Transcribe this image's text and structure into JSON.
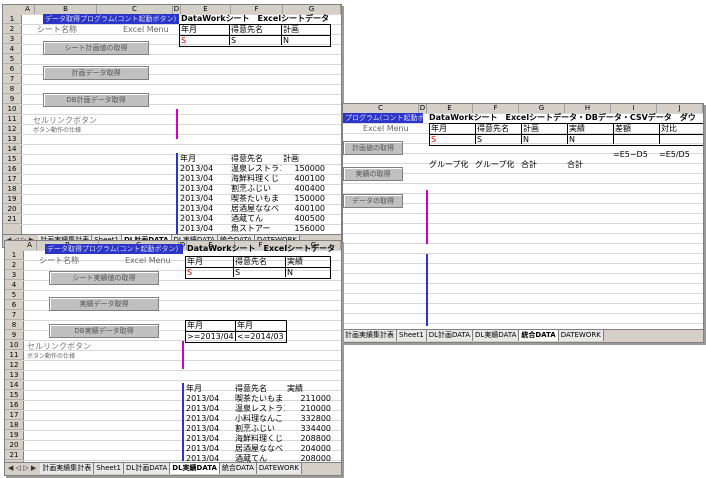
{
  "left_top": {
    "columns": [
      "A",
      "B",
      "C",
      "D",
      "E",
      "F",
      "G"
    ],
    "row_numbers": [
      "1",
      "2",
      "3",
      "4",
      "5",
      "6",
      "7",
      "8",
      "9",
      "10",
      "11",
      "12",
      "13",
      "14",
      "15",
      "16",
      "17",
      "18",
      "19",
      "20",
      "21"
    ],
    "bluebar_text": "データ取得プログラム(コント起動ボタン)",
    "header_strip": "DataWorkシート　Excelシートデータ",
    "menu_label_left": "シート名称",
    "menu_label_right": "Excel Menu",
    "buttons": [
      "シート計画値の取得",
      "計画データ取得",
      "DB計画データ取得"
    ],
    "cell_link_title": "セルリンクボタン",
    "cell_link_sub": "ボタン動作の仕様",
    "top_box": {
      "headers": [
        "年月",
        "得意先名",
        "計画"
      ],
      "values": [
        "S",
        "S",
        "N"
      ]
    },
    "table_headers": [
      "年月",
      "得意先名",
      "計画"
    ],
    "rows": [
      [
        "2013/04",
        "温泉レストラン",
        "150000"
      ],
      [
        "2013/04",
        "海鮮料理くじ",
        "400100"
      ],
      [
        "2013/04",
        "割烹ふじい",
        "400400"
      ],
      [
        "2013/04",
        "喫茶たいもま",
        "150000"
      ],
      [
        "2013/04",
        "居酒屋ななべ",
        "400100"
      ],
      [
        "2013/04",
        "酒蔵てん",
        "400500"
      ],
      [
        "2013/04",
        "魚ストアー",
        "156000"
      ]
    ],
    "tabs": [
      "計画実績集計表",
      "Sheet1",
      "DL計画DATA",
      "DL実績DATA",
      "統合DATA",
      "DATEWORK"
    ],
    "active_tab": "DL計画DATA"
  },
  "right": {
    "columns": [
      "C",
      "D",
      "E",
      "F",
      "G",
      "H",
      "I",
      "J"
    ],
    "row_numbers": [
      "1",
      "2",
      "3",
      "4",
      "5",
      "6",
      "7",
      "8",
      "9",
      "10",
      "11",
      "12",
      "13",
      "14"
    ],
    "bluebar_text": "プログラム(コント起動ボタン)",
    "header_strip": "DataWorkシート　Excelシートデータ・DBデータ・CSVデータ　ダウ",
    "menu_label": "Excel Menu",
    "buttons": [
      "計画値の取得",
      "実績の取得",
      "データの取得"
    ],
    "headers": [
      "年月",
      "得意先名",
      "計画",
      "実績",
      "差額",
      "対比"
    ],
    "types": [
      "S",
      "S",
      "N",
      "N",
      "",
      ""
    ],
    "formulas": [
      "",
      "",
      "",
      "",
      "=E5−D5",
      "=E5/D5"
    ],
    "group_row": [
      "グループ化",
      "グループ化",
      "合計",
      "合計",
      "",
      ""
    ],
    "tabs": [
      "計画実績集計表",
      "Sheet1",
      "DL計画DATA",
      "DL実績DATA",
      "統合DATA",
      "DATEWORK"
    ],
    "active_tab": "統合DATA"
  },
  "left_bottom": {
    "columns": [
      "A",
      "B",
      "C",
      "D",
      "E",
      "F",
      "G"
    ],
    "row_numbers": [
      "1",
      "2",
      "3",
      "4",
      "5",
      "6",
      "7",
      "8",
      "9",
      "10",
      "11",
      "12",
      "13",
      "14",
      "15",
      "16",
      "17",
      "18",
      "19",
      "20",
      "21"
    ],
    "bluebar_text": "データ取得プログラム(コント起動ボタン)",
    "header_strip": "DataWorkシート　Excelシートデータ",
    "menu_label_left": "シート名称",
    "menu_label_right": "Excel Menu",
    "buttons": [
      "シート実績値の取得",
      "実績データ取得",
      "DB実績データ取得"
    ],
    "top_box": {
      "headers": [
        "年月",
        "得意先名",
        "実績"
      ],
      "values": [
        "S",
        "S",
        "N"
      ]
    },
    "cond_box": {
      "headers": [
        "年月",
        "年月"
      ],
      "values": [
        ">=2013/04",
        "<=2014/03"
      ]
    },
    "cell_link_title": "セルリンクボタン",
    "cell_link_sub": "ボタン動作の仕様",
    "table_headers": [
      "年月",
      "得意先名",
      "実績"
    ],
    "rows": [
      [
        "2013/04",
        "喫茶たいもま",
        "211000"
      ],
      [
        "2013/04",
        "温泉レストラン",
        "210000"
      ],
      [
        "2013/04",
        "小料理なんこ",
        "332800"
      ],
      [
        "2013/04",
        "割烹ふじい",
        "334400"
      ],
      [
        "2013/04",
        "海鮮料理くじ",
        "208800"
      ],
      [
        "2013/04",
        "居酒屋ななべ",
        "204000"
      ],
      [
        "2013/04",
        "酒蔵てん",
        "208000"
      ]
    ],
    "tabs": [
      "計画実績集計表",
      "Sheet1",
      "DL計画DATA",
      "DL実績DATA",
      "統合DATA",
      "DATEWORK"
    ],
    "active_tab": "DL実績DATA"
  }
}
